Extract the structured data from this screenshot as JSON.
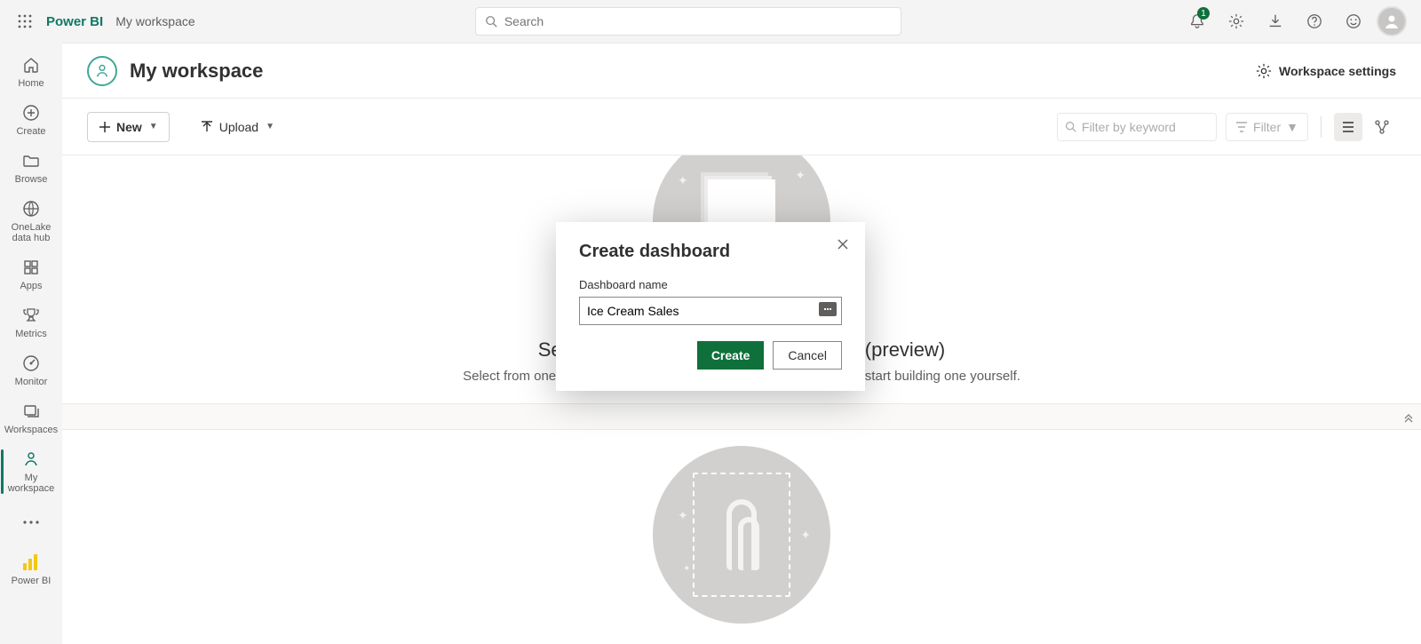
{
  "topbar": {
    "brand": "Power BI",
    "breadcrumb": "My workspace",
    "search_placeholder": "Search",
    "notification_count": "1"
  },
  "leftrail": {
    "items": [
      {
        "label": "Home"
      },
      {
        "label": "Create"
      },
      {
        "label": "Browse"
      },
      {
        "label": "OneLake data hub"
      },
      {
        "label": "Apps"
      },
      {
        "label": "Metrics"
      },
      {
        "label": "Monitor"
      },
      {
        "label": "Workspaces"
      },
      {
        "label": "My workspace"
      }
    ],
    "bottom_label": "Power BI"
  },
  "workspace": {
    "title": "My workspace",
    "settings_label": "Workspace settings"
  },
  "toolbar": {
    "new_label": "New",
    "upload_label": "Upload",
    "filter_placeholder": "Filter by keyword",
    "filter_button": "Filter"
  },
  "empty_state": {
    "heading": "Select a built-in sample to get started (preview)",
    "subheading": "Select from one of the built-in samples to view and interact with it or start building one yourself."
  },
  "modal": {
    "title": "Create dashboard",
    "field_label": "Dashboard name",
    "field_value": "Ice Cream Sales",
    "create_label": "Create",
    "cancel_label": "Cancel"
  }
}
